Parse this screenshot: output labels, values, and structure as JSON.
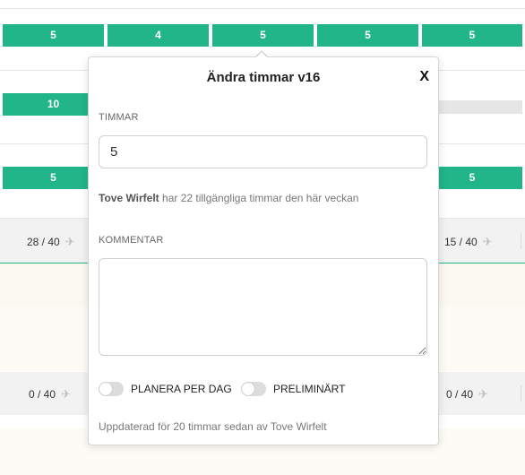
{
  "grid": {
    "row1_cells": [
      "5",
      "4",
      "5",
      "5",
      "5"
    ],
    "row2_cells": [
      "10"
    ],
    "row3_cells": [
      "5",
      "5"
    ],
    "summary_row1": {
      "left": "28 / 40",
      "right": "15 / 40"
    },
    "summary_row2": {
      "left": "0 / 40",
      "right": "0 / 40"
    }
  },
  "modal": {
    "title": "Ändra timmar v16",
    "close_label": "X",
    "hours_label": "TIMMAR",
    "hours_value": "5",
    "availability_name": "Tove Wirfelt",
    "availability_text": " har 22 tillgängliga timmar den här veckan",
    "comment_label": "KOMMENTAR",
    "comment_value": "",
    "toggle_plan_per_day": "PLANERA PER DAG",
    "toggle_preliminary": "PRELIMINÄRT",
    "updated_text": "Uppdaterad för 20 timmar sedan av Tove Wirfelt"
  },
  "colors": {
    "accent": "#22b58a",
    "toggle_off": "#dcdcdc"
  },
  "icons": {
    "plane": "plane-icon"
  }
}
